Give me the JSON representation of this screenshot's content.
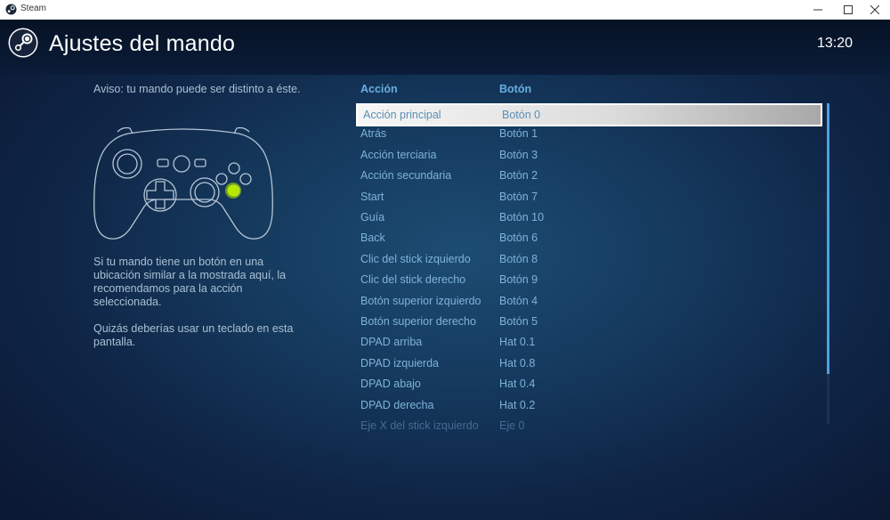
{
  "window": {
    "app_title": "Steam",
    "icons": [
      "steam-icon",
      "minimize-icon",
      "maximize-icon",
      "close-icon"
    ]
  },
  "header": {
    "title": "Ajustes del mando",
    "clock": "13:20"
  },
  "left": {
    "notice": "Aviso: tu mando puede ser distinto a éste.",
    "advice": "Si tu mando tiene un botón en una ubicación similar a la mostrada aquí, la recomendamos para la acción seleccionada.",
    "keyboard_hint": "Quizás deberías usar un teclado en esta pantalla.",
    "highlight_color": "#b6e800"
  },
  "table": {
    "headers": {
      "action": "Acción",
      "button": "Botón"
    },
    "rows": [
      {
        "action": "Acción principal",
        "button": "Botón 0"
      },
      {
        "action": "Atrás",
        "button": "Botón 1"
      },
      {
        "action": "Acción terciaria",
        "button": "Botón 3"
      },
      {
        "action": "Acción secundaria",
        "button": "Botón 2"
      },
      {
        "action": "Start",
        "button": "Botón 7"
      },
      {
        "action": "Guía",
        "button": "Botón 10"
      },
      {
        "action": "Back",
        "button": "Botón 6"
      },
      {
        "action": "Clic del stick izquierdo",
        "button": "Botón 8"
      },
      {
        "action": "Clic del stick derecho",
        "button": "Botón 9"
      },
      {
        "action": "Botón superior izquierdo",
        "button": "Botón 4"
      },
      {
        "action": "Botón superior derecho",
        "button": "Botón 5"
      },
      {
        "action": "DPAD arriba",
        "button": "Hat 0.1"
      },
      {
        "action": "DPAD izquierda",
        "button": "Hat 0.8"
      },
      {
        "action": "DPAD abajo",
        "button": "Hat 0.4"
      },
      {
        "action": "DPAD derecha",
        "button": "Hat 0.2"
      },
      {
        "action": "Eje X del stick izquierdo",
        "button": "Eje 0"
      }
    ],
    "selected_index": 0
  },
  "colors": {
    "accent": "#67aee0",
    "text": "#7fb2d9",
    "scroll": "#4f9fe0"
  }
}
